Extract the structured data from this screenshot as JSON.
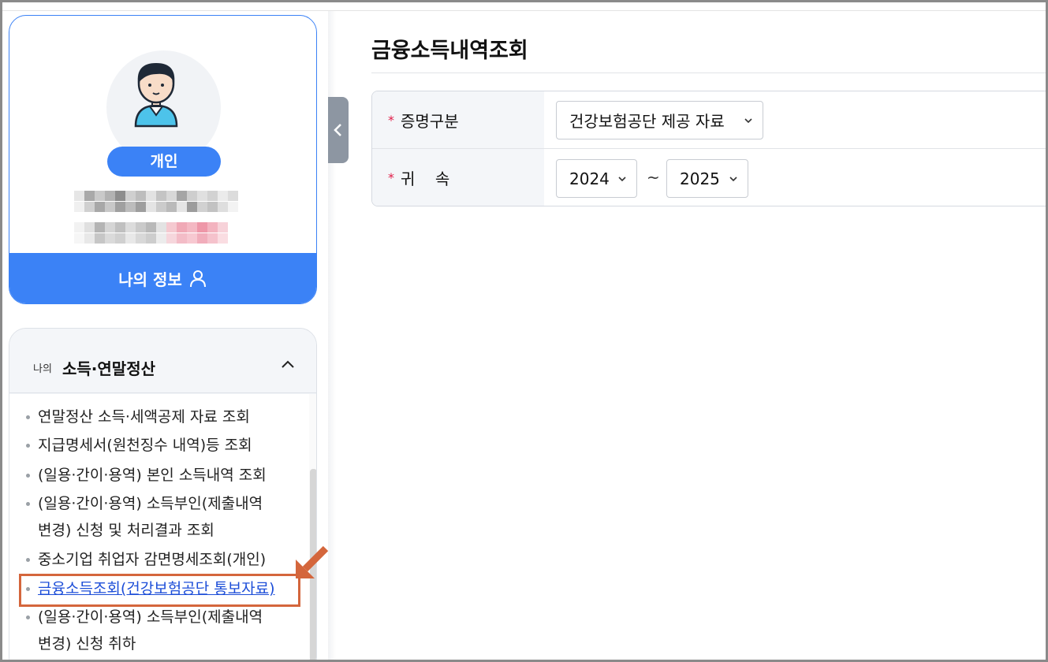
{
  "profile": {
    "badge": "개인",
    "my_info_button": "나의 정보"
  },
  "menu": {
    "header_small": "나의",
    "header_title": "소득·연말정산",
    "items": [
      "연말정산 소득·세액공제 자료 조회",
      "지급명세서(원천징수 내역)등 조회",
      "(일용·간이·용역) 본인 소득내역 조회",
      "(일용·간이·용역) 소득부인(제출내역",
      "변경) 신청 및 처리결과 조회",
      "중소기업 취업자 감면명세조회(개인)",
      "금융소득조회(건강보험공단 통보자료)",
      "(일용·간이·용역) 소득부인(제출내역",
      "변경) 신청 취하"
    ]
  },
  "main": {
    "title": "금융소득내역조회",
    "form": {
      "row1_label": "증명구분",
      "row1_value": "건강보험공단 제공 자료",
      "row2_label": "귀    속",
      "year_from": "2024",
      "separator": "~",
      "year_to": "2025"
    }
  },
  "colors": {
    "primary": "#3b82f6",
    "highlight": "#d4663c",
    "required": "#e11d48"
  }
}
